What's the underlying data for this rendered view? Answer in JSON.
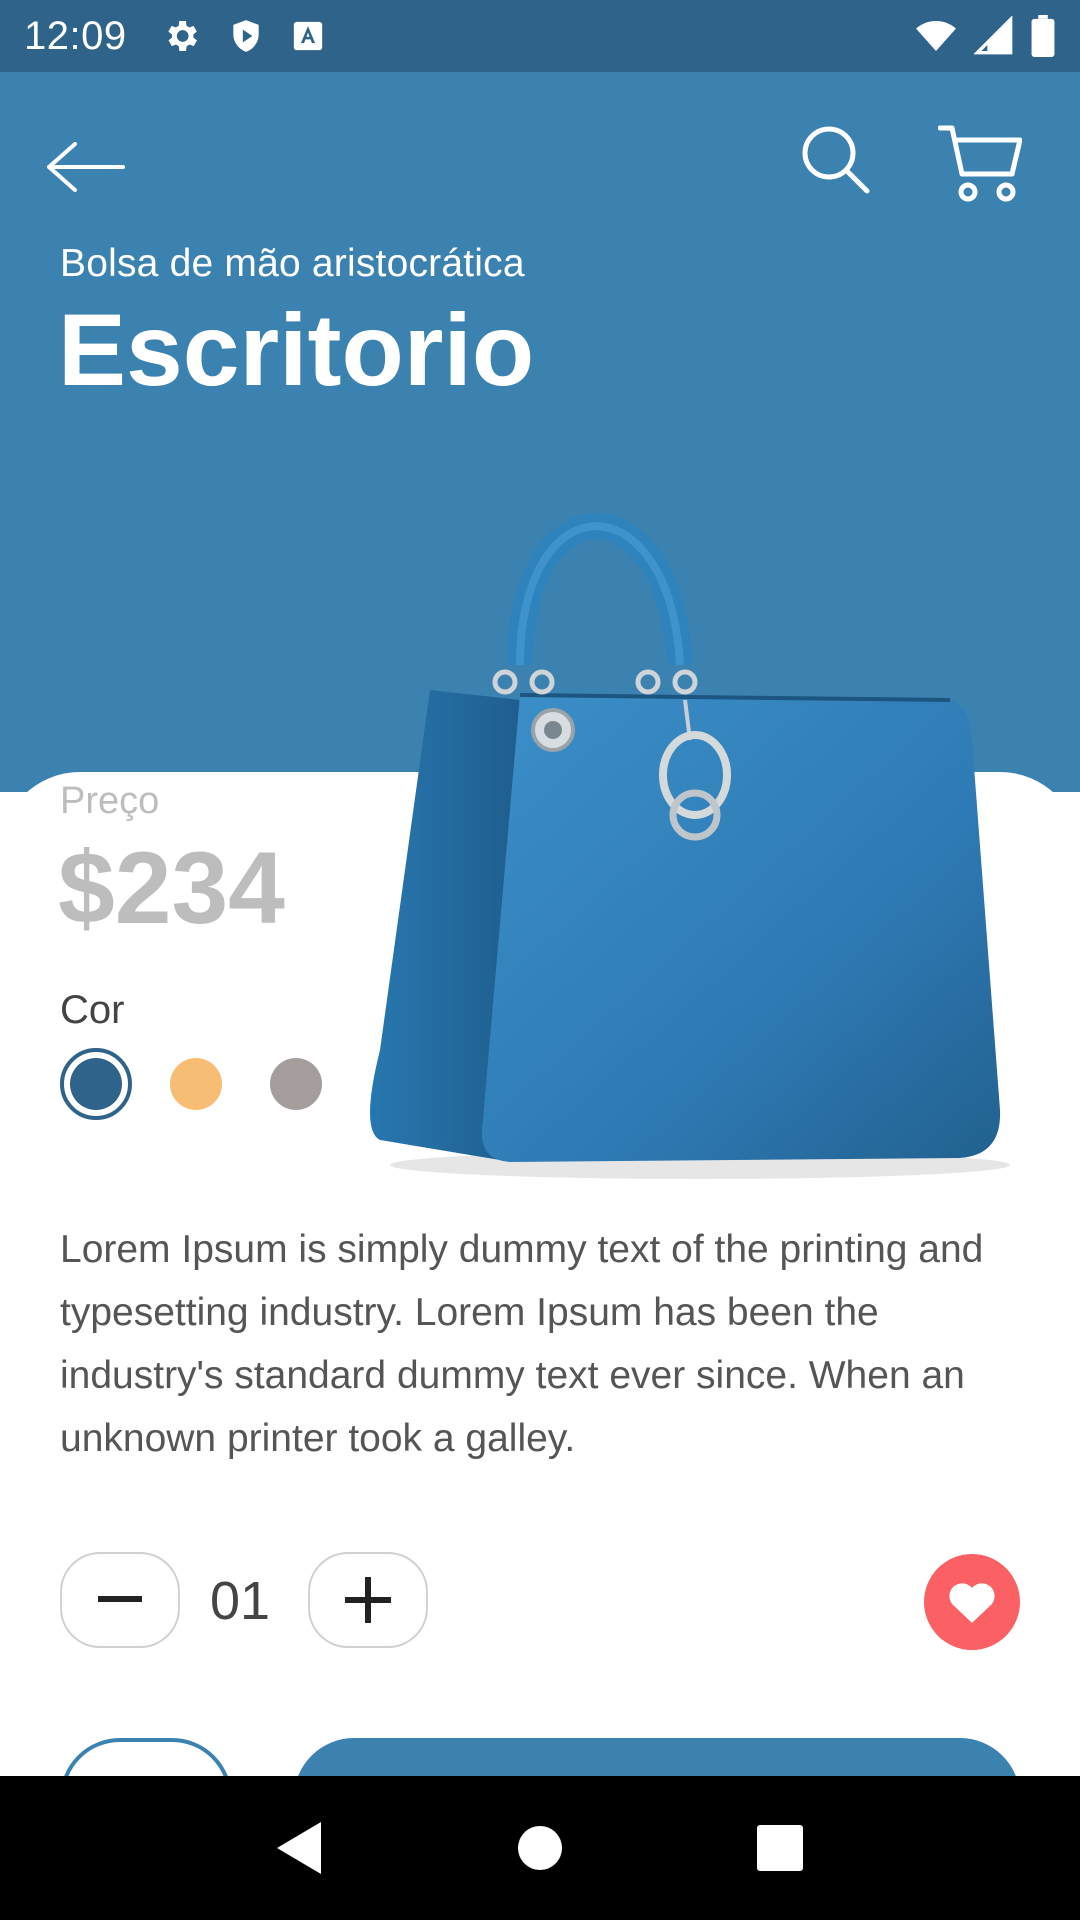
{
  "status_bar": {
    "time": "12:09",
    "left_icons": [
      "gear-icon",
      "shield-play-icon",
      "font-a-icon"
    ],
    "right_icons": [
      "wifi-icon",
      "signal-icon",
      "battery-icon"
    ]
  },
  "header": {
    "back_icon": "arrow-left-icon",
    "search_icon": "search-icon",
    "cart_icon": "cart-icon"
  },
  "product": {
    "subtitle": "Bolsa de mão aristocrática",
    "title": "Escritorio",
    "price_label": "Preço",
    "price": "$234",
    "color_label": "Cor",
    "colors": [
      "#2f6389",
      "#f7bd74",
      "#a59c9c"
    ],
    "selected_color": 0,
    "description": "Lorem Ipsum is simply dummy text of the printing and typesetting industry. Lorem Ipsum has been the industry's standard dummy text ever since. When an unknown printer took a galley."
  },
  "quantity": {
    "value": "01"
  },
  "theme": {
    "primary": "#3c82b0",
    "status_bar": "#2f6389",
    "favorite": "#fb6065"
  }
}
